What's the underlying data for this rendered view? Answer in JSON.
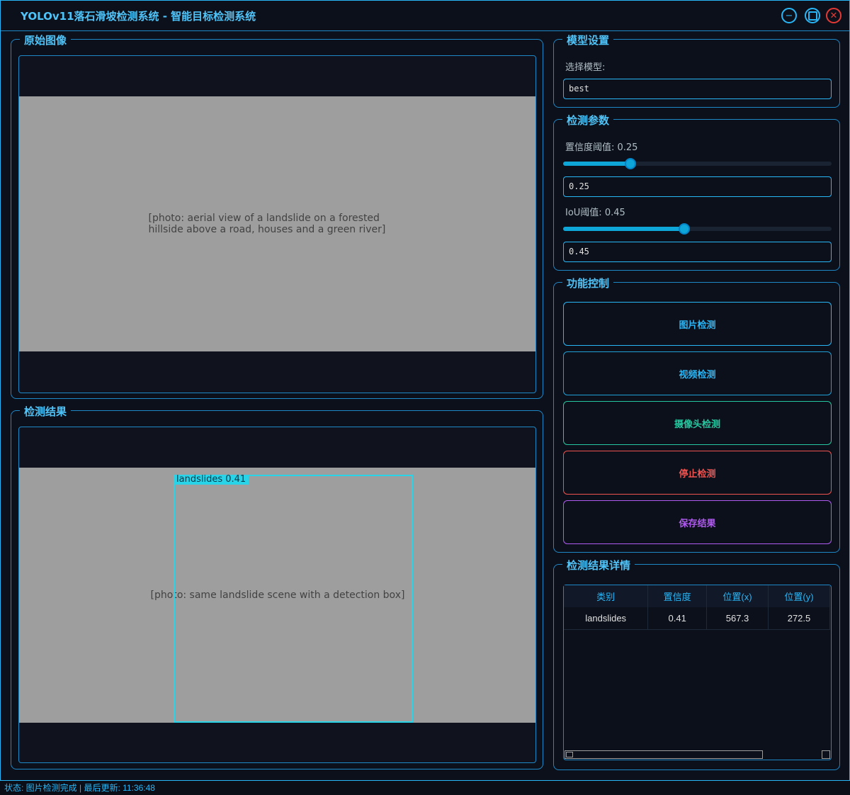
{
  "window": {
    "title": "YOLOv11落石滑坡检测系统 - 智能目标检测系统"
  },
  "panels": {
    "original": {
      "title": "原始图像",
      "image": "[photo: aerial view of a landslide on a forested hillside above a road, houses and a green river]"
    },
    "result": {
      "title": "检测结果",
      "image": "[photo: same landslide scene with a detection box]",
      "detection_label": "landslides 0.41"
    }
  },
  "model": {
    "title": "模型设置",
    "select_label": "选择模型:",
    "selected": "best"
  },
  "params": {
    "title": "检测参数",
    "confidence": {
      "label": "置信度阈值: 0.25",
      "value": 0.25,
      "input": "0.25"
    },
    "iou": {
      "label": "IoU阈值: 0.45",
      "value": 0.45,
      "input": "0.45"
    }
  },
  "controls": {
    "title": "功能控制",
    "buttons": [
      "图片检测",
      "视频检测",
      "摄像头检测",
      "停止检测",
      "保存结果"
    ]
  },
  "details": {
    "title": "检测结果详情",
    "columns": [
      "类别",
      "置信度",
      "位置(x)",
      "位置(y)"
    ],
    "rows": [
      [
        "landslides",
        "0.41",
        "567.3",
        "272.5"
      ]
    ]
  },
  "status": "状态: 图片检测完成 | 最后更新: 11:36:48",
  "colors": {
    "accent": "#29b6f6",
    "teal": "#26c6a0",
    "red": "#ef5350",
    "purple": "#b05bf0",
    "background": "#0c101a"
  }
}
